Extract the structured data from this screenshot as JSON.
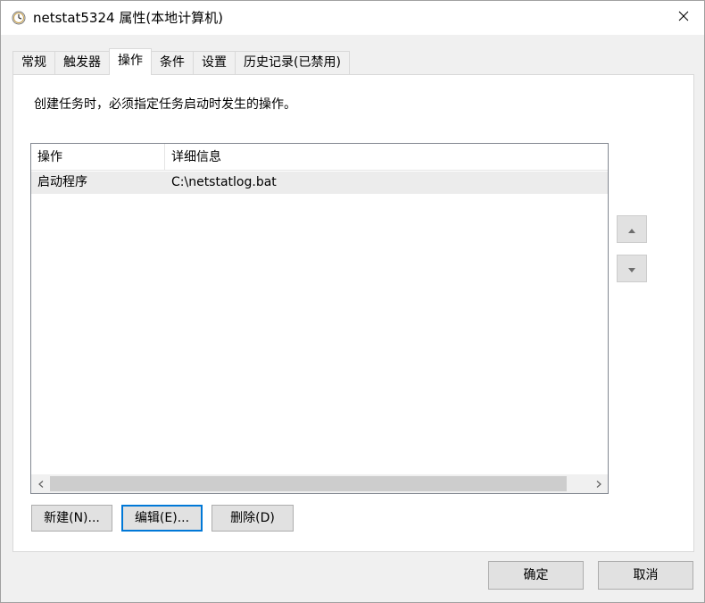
{
  "window": {
    "title": "netstat5324 属性(本地计算机)"
  },
  "tabs": [
    {
      "label": "常规",
      "active": false
    },
    {
      "label": "触发器",
      "active": false
    },
    {
      "label": "操作",
      "active": true
    },
    {
      "label": "条件",
      "active": false
    },
    {
      "label": "设置",
      "active": false
    },
    {
      "label": "历史记录(已禁用)",
      "active": false
    }
  ],
  "actions_tab": {
    "instruction": "创建任务时，必须指定任务启动时发生的操作。",
    "columns": [
      "操作",
      "详细信息"
    ],
    "rows": [
      {
        "action": "启动程序",
        "details": "C:\\netstatlog.bat"
      }
    ],
    "buttons": {
      "new": "新建(N)...",
      "edit": "编辑(E)...",
      "delete": "删除(D)"
    }
  },
  "dialog_buttons": {
    "ok": "确定",
    "cancel": "取消"
  },
  "colors": {
    "focus_border": "#0078d7",
    "selected_row": "#ececec"
  },
  "icons": {
    "title": "clock-icon",
    "close": "close-icon",
    "move_up": "triangle-up-icon",
    "move_down": "triangle-down-icon"
  }
}
